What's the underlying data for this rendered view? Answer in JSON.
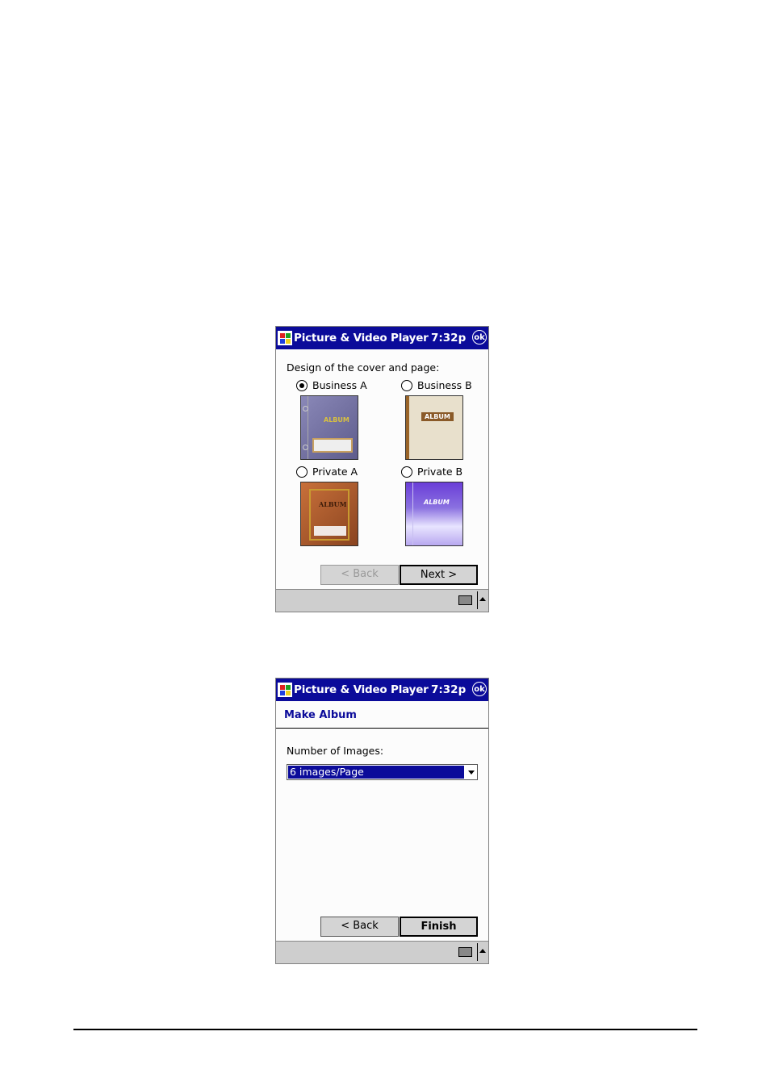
{
  "screens": [
    {
      "titlebar": {
        "app_title": "Picture & Video Player",
        "clock": "7:32p",
        "ok_label": "ok",
        "logo_icon": "windows-flag-icon"
      },
      "prompt": "Design of the cover and page:",
      "options": [
        {
          "label": "Business A",
          "selected": true,
          "thumb_text": "ALBUM",
          "thumb_color": "#7a7aa8"
        },
        {
          "label": "Business B",
          "selected": false,
          "thumb_text": "ALBUM",
          "thumb_color": "#e8e0cc"
        },
        {
          "label": "Private A",
          "selected": false,
          "thumb_text": "ALBUM",
          "thumb_color": "#b5642f"
        },
        {
          "label": "Private B",
          "selected": false,
          "thumb_text": "ALBUM",
          "thumb_color": "#7a55d6"
        }
      ],
      "buttons": {
        "back": "< Back",
        "next": "Next >"
      },
      "taskbar": {
        "keyboard_icon": "keyboard-icon",
        "sip_arrow_icon": "up-arrow-icon"
      }
    },
    {
      "titlebar": {
        "app_title": "Picture & Video Player",
        "clock": "7:32p",
        "ok_label": "ok",
        "logo_icon": "windows-flag-icon"
      },
      "heading": "Make Album",
      "field_label": "Number of Images:",
      "select_value": "6 images/Page",
      "buttons": {
        "back": "< Back",
        "finish": "Finish"
      },
      "taskbar": {
        "keyboard_icon": "keyboard-icon",
        "sip_arrow_icon": "up-arrow-icon"
      }
    }
  ],
  "colors": {
    "titlebar": "#0b0b9a",
    "selection": "#0b0b9a",
    "taskbar": "#cecece"
  }
}
